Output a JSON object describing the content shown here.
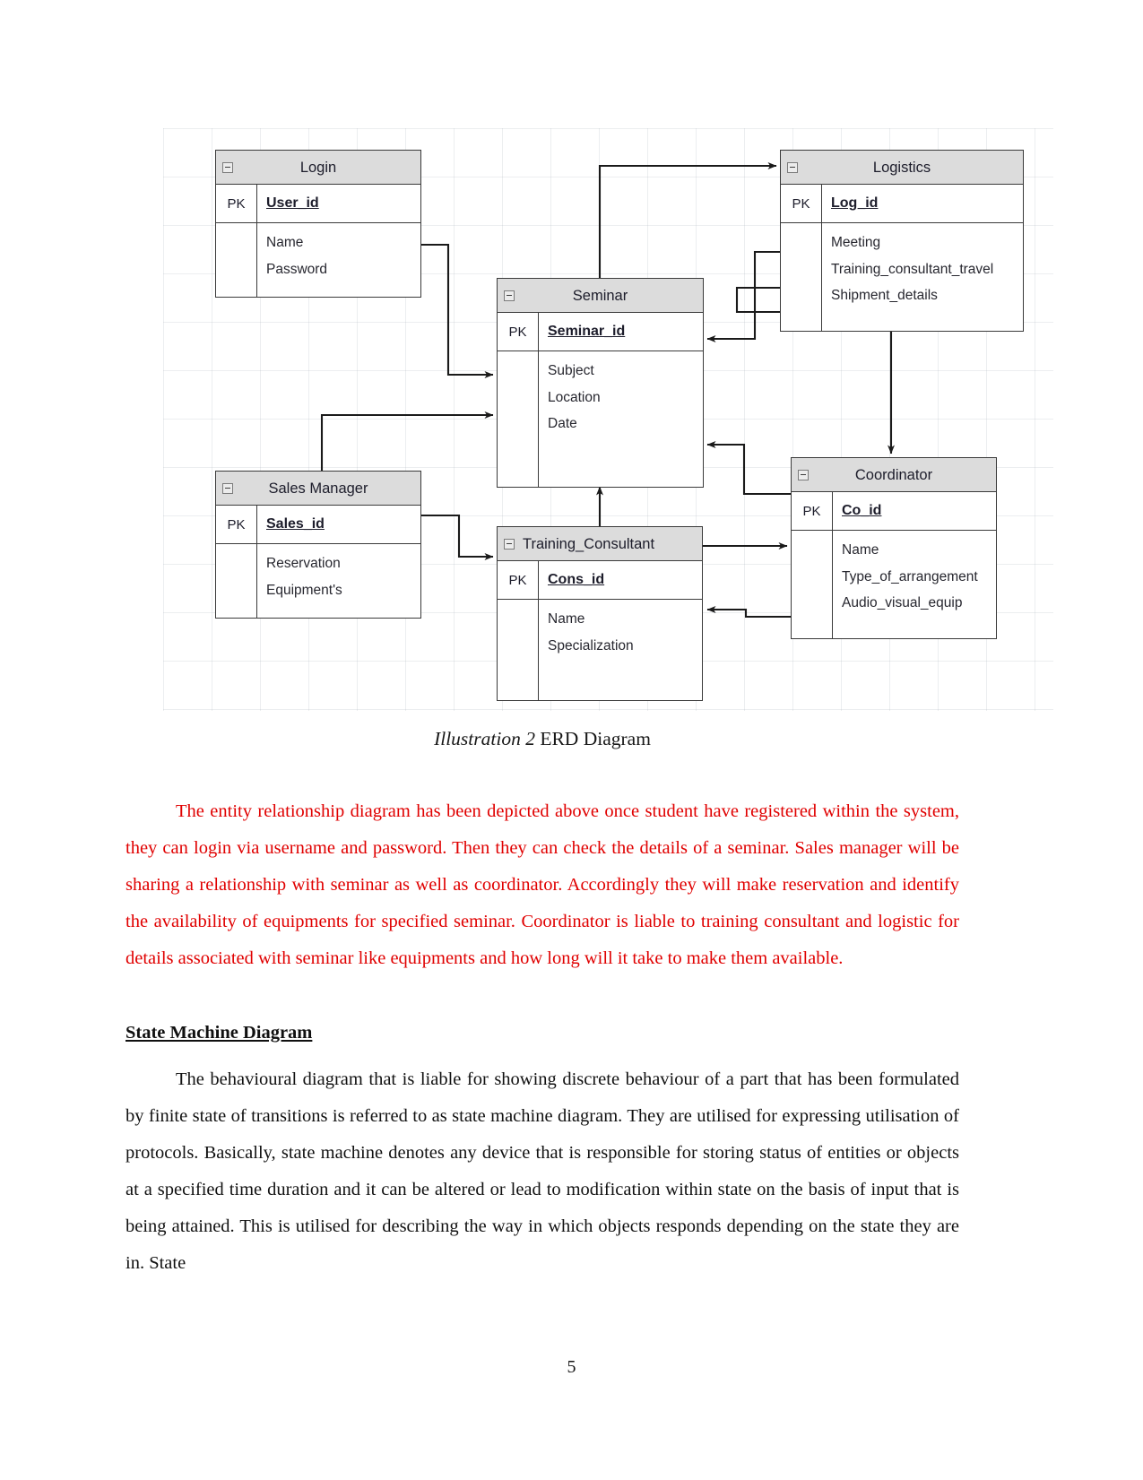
{
  "figure": {
    "caption_italic": "Illustration 2",
    "caption_rest": " ERD Diagram",
    "entities": [
      {
        "id": "login",
        "title": "Login",
        "pk_label": "PK",
        "pk_attribute": "User_id",
        "attributes": [
          "Name",
          "Password"
        ]
      },
      {
        "id": "logistics",
        "title": "Logistics",
        "pk_label": "PK",
        "pk_attribute": "Log_id",
        "attributes": [
          "Meeting",
          "Training_consultant_travel",
          "Shipment_details"
        ]
      },
      {
        "id": "seminar",
        "title": "Seminar",
        "pk_label": "PK",
        "pk_attribute": "Seminar_id",
        "attributes": [
          "Subject",
          "Location",
          "Date"
        ]
      },
      {
        "id": "sales_manager",
        "title": "Sales Manager",
        "pk_label": "PK",
        "pk_attribute": "Sales_id",
        "attributes": [
          "Reservation",
          "Equipment's"
        ]
      },
      {
        "id": "training_consultant",
        "title": "Training_Consultant",
        "pk_label": "PK",
        "pk_attribute": "Cons_id",
        "attributes": [
          "Name",
          "Specialization"
        ]
      },
      {
        "id": "coordinator",
        "title": "Coordinator",
        "pk_label": "PK",
        "pk_attribute": "Co_id",
        "attributes": [
          "Name",
          "Type_of_arrangement",
          "Audio_visual_equip"
        ]
      }
    ],
    "relationships": [
      {
        "from": "Login",
        "to": "Seminar"
      },
      {
        "from": "Sales Manager",
        "to": "Seminar"
      },
      {
        "from": "Seminar",
        "to": "Logistics"
      },
      {
        "from": "Logistics",
        "to": "Seminar"
      },
      {
        "from": "Logistics",
        "to": "Coordinator"
      },
      {
        "from": "Coordinator",
        "to": "Seminar"
      },
      {
        "from": "Training_Consultant",
        "to": "Seminar"
      },
      {
        "from": "Sales Manager",
        "to": "Training_Consultant"
      },
      {
        "from": "Training_Consultant",
        "to": "Coordinator"
      },
      {
        "from": "Coordinator",
        "to": "Training_Consultant"
      }
    ]
  },
  "body": {
    "paragraph_red": "The entity relationship diagram has been depicted above once student have registered within the system, they can login via username and password. Then they can check the details of a seminar. Sales manager will be sharing a relationship with seminar as well as coordinator. Accordingly they will make reservation and identify the availability of equipments for specified seminar. Coordinator is liable to training consultant and logistic for details associated with seminar like equipments and how long will it take to make them available.",
    "heading": "State Machine Diagram",
    "paragraph_black": "The behavioural diagram that is liable for showing discrete behaviour of a part that has been formulated by finite state of transitions is referred to as state machine diagram. They are utilised for expressing utilisation of protocols. Basically, state machine denotes any device that is responsible for storing status of entities or objects at a specified time duration and it can be altered or lead to modification within state on the basis of input that is being attained. This is utilised for describing the way in which objects responds depending on the state they are in. State"
  },
  "page_number": "5"
}
